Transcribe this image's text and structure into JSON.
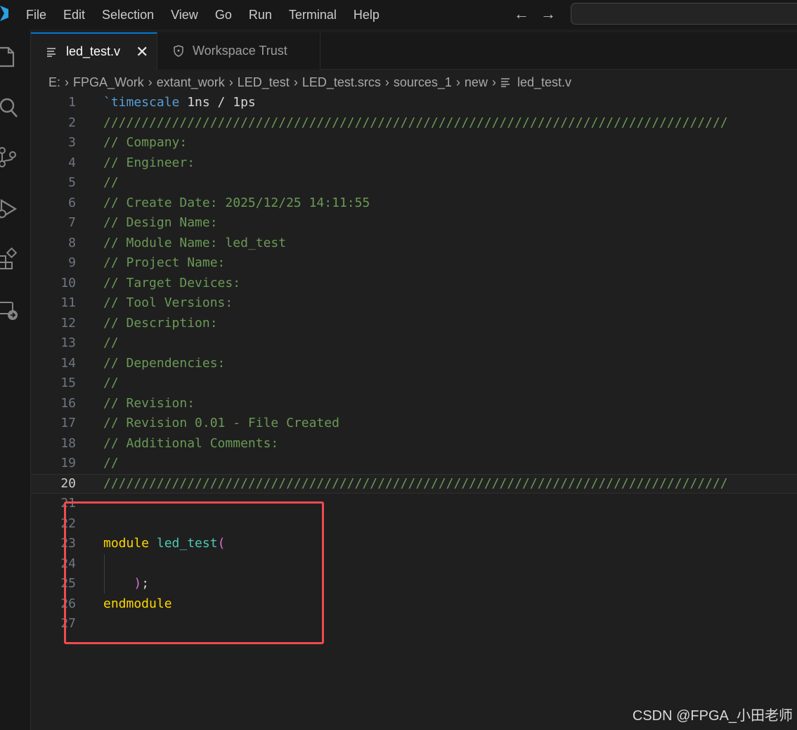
{
  "menu": {
    "items": [
      "File",
      "Edit",
      "Selection",
      "View",
      "Go",
      "Run",
      "Terminal",
      "Help"
    ]
  },
  "nav": {
    "back_icon": "arrow-left-icon",
    "forward_icon": "arrow-right-icon"
  },
  "activity_bar": {
    "icons": [
      "explorer-icon",
      "search-icon",
      "source-control-icon",
      "run-debug-icon",
      "extensions-icon",
      "remote-explorer-icon"
    ]
  },
  "tabs": [
    {
      "label": "led_test.v",
      "icon": "file-lines-icon",
      "active": true
    },
    {
      "label": "Workspace Trust",
      "icon": "shield-icon",
      "active": false
    }
  ],
  "breadcrumb": [
    "E:",
    "FPGA_Work",
    "extant_work",
    "LED_test",
    "LED_test.srcs",
    "sources_1",
    "new",
    "led_test.v"
  ],
  "editor": {
    "current_line": 20,
    "lines": [
      {
        "n": "1",
        "tokens": [
          [
            "directive",
            "`timescale"
          ],
          [
            "plain",
            " 1ns / 1ps"
          ]
        ]
      },
      {
        "n": "2",
        "tokens": [
          [
            "comment",
            "//////////////////////////////////////////////////////////////////////////////////"
          ]
        ]
      },
      {
        "n": "3",
        "tokens": [
          [
            "comment",
            "// Company: "
          ]
        ]
      },
      {
        "n": "4",
        "tokens": [
          [
            "comment",
            "// Engineer: "
          ]
        ]
      },
      {
        "n": "5",
        "tokens": [
          [
            "comment",
            "// "
          ]
        ]
      },
      {
        "n": "6",
        "tokens": [
          [
            "comment",
            "// Create Date: 2025/12/25 14:11:55"
          ]
        ]
      },
      {
        "n": "7",
        "tokens": [
          [
            "comment",
            "// Design Name: "
          ]
        ]
      },
      {
        "n": "8",
        "tokens": [
          [
            "comment",
            "// Module Name: led_test"
          ]
        ]
      },
      {
        "n": "9",
        "tokens": [
          [
            "comment",
            "// Project Name: "
          ]
        ]
      },
      {
        "n": "10",
        "tokens": [
          [
            "comment",
            "// Target Devices: "
          ]
        ]
      },
      {
        "n": "11",
        "tokens": [
          [
            "comment",
            "// Tool Versions: "
          ]
        ]
      },
      {
        "n": "12",
        "tokens": [
          [
            "comment",
            "// Description: "
          ]
        ]
      },
      {
        "n": "13",
        "tokens": [
          [
            "comment",
            "// "
          ]
        ]
      },
      {
        "n": "14",
        "tokens": [
          [
            "comment",
            "// Dependencies: "
          ]
        ]
      },
      {
        "n": "15",
        "tokens": [
          [
            "comment",
            "// "
          ]
        ]
      },
      {
        "n": "16",
        "tokens": [
          [
            "comment",
            "// Revision:"
          ]
        ]
      },
      {
        "n": "17",
        "tokens": [
          [
            "comment",
            "// Revision 0.01 - File Created"
          ]
        ]
      },
      {
        "n": "18",
        "tokens": [
          [
            "comment",
            "// Additional Comments:"
          ]
        ]
      },
      {
        "n": "19",
        "tokens": [
          [
            "comment",
            "// "
          ]
        ]
      },
      {
        "n": "20",
        "tokens": [
          [
            "comment",
            "//////////////////////////////////////////////////////////////////////////////////"
          ]
        ]
      },
      {
        "n": "21",
        "tokens": []
      },
      {
        "n": "22",
        "tokens": []
      },
      {
        "n": "23",
        "tokens": [
          [
            "keyword",
            "module"
          ],
          [
            "plain",
            " "
          ],
          [
            "ident",
            "led_test"
          ],
          [
            "paren",
            "("
          ]
        ]
      },
      {
        "n": "24",
        "tokens": []
      },
      {
        "n": "25",
        "tokens": [
          [
            "plain",
            "    "
          ],
          [
            "paren",
            ")"
          ],
          [
            "plain",
            ";"
          ]
        ]
      },
      {
        "n": "26",
        "tokens": [
          [
            "keyword",
            "endmodule"
          ]
        ]
      },
      {
        "n": "27",
        "tokens": []
      }
    ]
  },
  "watermark": "CSDN @FPGA_小田老师",
  "colors": {
    "accent": "#0078d4",
    "highlight_box": "#f04a4f",
    "comment": "#6a9955",
    "keyword": "#ffd700",
    "identifier": "#4ec9b0"
  }
}
